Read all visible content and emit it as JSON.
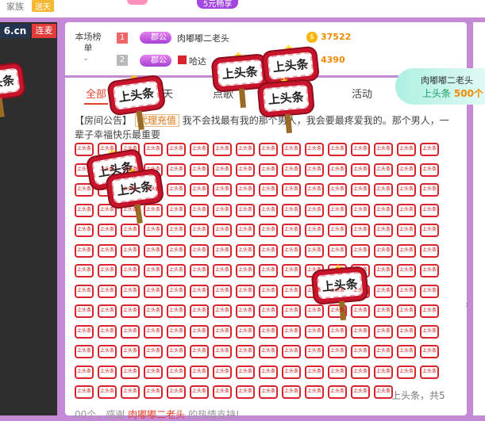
{
  "header": {
    "clan_label": "家族",
    "clan_badge": "送天",
    "promo": "5元畅享"
  },
  "left": {
    "logo": "6.cn",
    "follow": "连麦"
  },
  "rank": {
    "title": "本场榜单",
    "rows": [
      {
        "num": "1",
        "badge": "郡公",
        "name": "肉嘟嘟二老头",
        "score": "37522"
      },
      {
        "num": "2",
        "badge": "郡公",
        "name": "哈达",
        "score": "4390"
      }
    ]
  },
  "tabs": [
    "全部",
    "天",
    "点歌",
    "活动"
  ],
  "announcement": {
    "label": "【房间公告】",
    "agent": "代理充值",
    "text": "我不会找最有我的那个男人，我会要最疼爱我的。那个男人，一辈子幸福快乐最重要"
  },
  "gift": {
    "name": "上头条",
    "mini": "上头条"
  },
  "banner": {
    "name": "肉嘟嘟二老头",
    "gift": "上头条",
    "count": "500个"
  },
  "bottom": {
    "count_text": "上头条，共5",
    "thanks_prefix": "00个，感谢",
    "thanks_name": "肉嘟嘟二老头",
    "thanks_suffix": "的热情支持!"
  },
  "colors": {
    "accent": "#e2422b",
    "brand": "#c48ad6",
    "gift_red": "#c8152b"
  }
}
